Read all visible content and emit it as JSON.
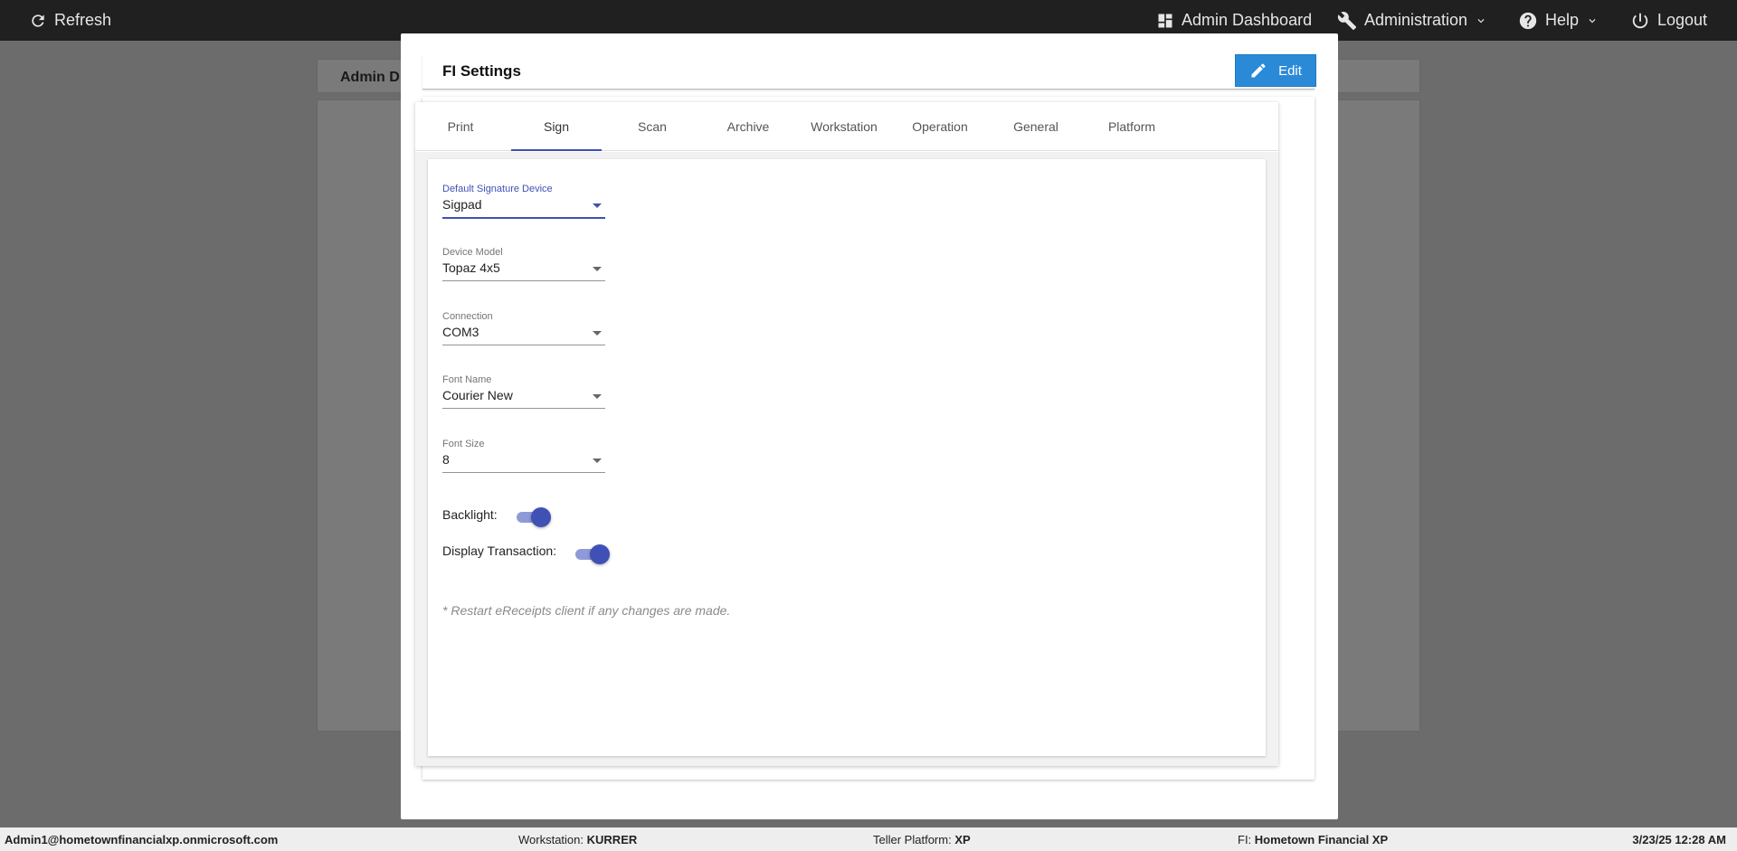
{
  "topbar": {
    "refresh_label": "Refresh",
    "admin_dashboard_label": "Admin Dashboard",
    "administration_label": "Administration",
    "help_label": "Help",
    "logout_label": "Logout"
  },
  "background": {
    "header_title": "Admin D"
  },
  "modal": {
    "title": "FI Settings",
    "edit_label": "Edit",
    "tabs": [
      {
        "label": "Print"
      },
      {
        "label": "Sign"
      },
      {
        "label": "Scan"
      },
      {
        "label": "Archive"
      },
      {
        "label": "Workstation"
      },
      {
        "label": "Operation"
      },
      {
        "label": "General"
      },
      {
        "label": "Platform"
      }
    ],
    "active_tab": "Sign",
    "fields": {
      "default_signature_device": {
        "label": "Default Signature Device",
        "value": "Sigpad"
      },
      "device_model": {
        "label": "Device Model",
        "value": "Topaz 4x5"
      },
      "connection": {
        "label": "Connection",
        "value": "COM3"
      },
      "font_name": {
        "label": "Font Name",
        "value": "Courier New"
      },
      "font_size": {
        "label": "Font Size",
        "value": "8"
      }
    },
    "toggles": {
      "backlight": {
        "label": "Backlight:",
        "on": true
      },
      "display_transaction": {
        "label": "Display Transaction:",
        "on": true
      }
    },
    "note": "* Restart eReceipts client if any changes are made."
  },
  "statusbar": {
    "user": "Admin1@hometownfinancialxp.onmicrosoft.com",
    "workstation_label": "Workstation:",
    "workstation_value": "KURRER",
    "platform_label": "Teller Platform:",
    "platform_value": "XP",
    "fi_label": "FI:",
    "fi_value": "Hometown Financial XP",
    "datetime": "3/23/25 12:28 AM"
  },
  "colors": {
    "accent": "#3f51b5",
    "edit_button": "#2b8ad8",
    "topbar": "#202020"
  }
}
